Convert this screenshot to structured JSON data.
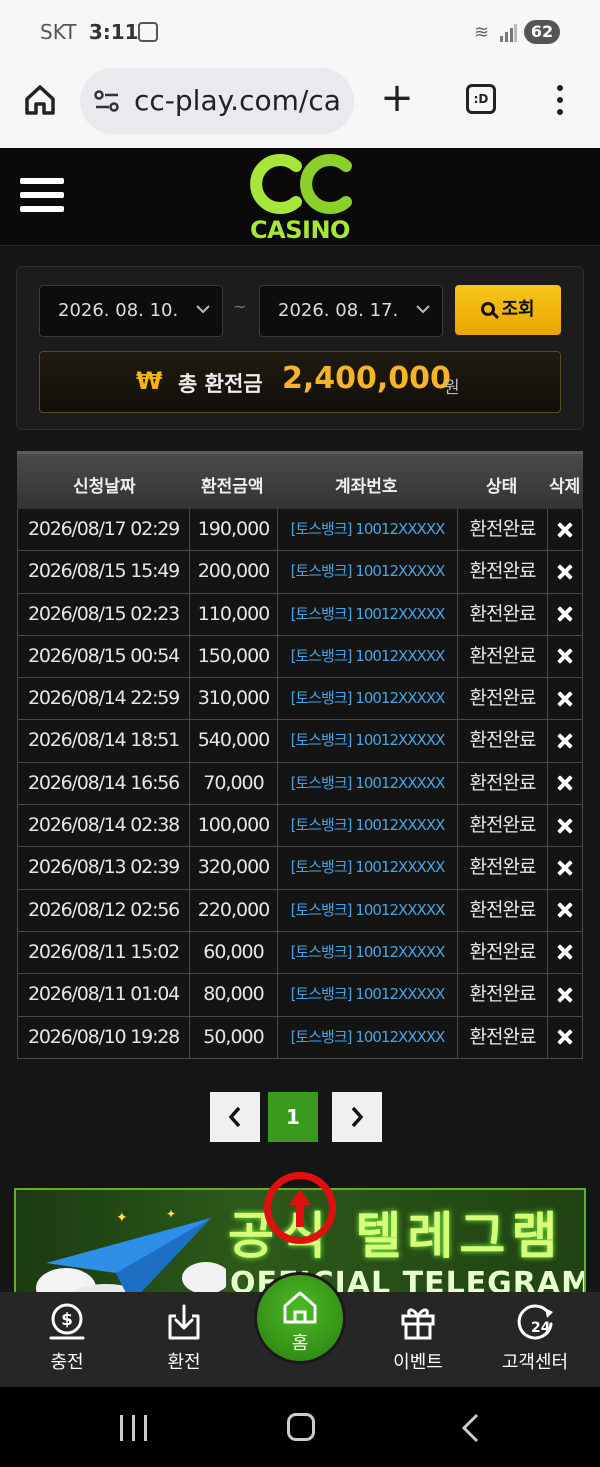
{
  "status_bar": {
    "carrier": "SKT",
    "time": "3:11",
    "battery": "62"
  },
  "browser": {
    "url": "cc-play.com/ca",
    "tabs_icon": ":D"
  },
  "site": {
    "logo_text": "CASINO"
  },
  "search": {
    "date_from": "2026. 08. 10.",
    "date_to": "2026. 08. 17.",
    "separator": "~",
    "button_label": "조회"
  },
  "summary": {
    "currency_symbol": "₩",
    "label": "총 환전금",
    "amount": "2,400,000",
    "unit": "원"
  },
  "table": {
    "headers": {
      "date": "신청날짜",
      "amount": "환전금액",
      "account": "계좌번호",
      "status": "상태",
      "delete": "삭제"
    },
    "rows": [
      {
        "date": "2026/08/17 02:29",
        "amount": "190,000",
        "account": "[토스뱅크] 10012XXXXX",
        "status": "환전완료"
      },
      {
        "date": "2026/08/15 15:49",
        "amount": "200,000",
        "account": "[토스뱅크] 10012XXXXX",
        "status": "환전완료"
      },
      {
        "date": "2026/08/15 02:23",
        "amount": "110,000",
        "account": "[토스뱅크] 10012XXXXX",
        "status": "환전완료"
      },
      {
        "date": "2026/08/15 00:54",
        "amount": "150,000",
        "account": "[토스뱅크] 10012XXXXX",
        "status": "환전완료"
      },
      {
        "date": "2026/08/14 22:59",
        "amount": "310,000",
        "account": "[토스뱅크] 10012XXXXX",
        "status": "환전완료"
      },
      {
        "date": "2026/08/14 18:51",
        "amount": "540,000",
        "account": "[토스뱅크] 10012XXXXX",
        "status": "환전완료"
      },
      {
        "date": "2026/08/14 16:56",
        "amount": "70,000",
        "account": "[토스뱅크] 10012XXXXX",
        "status": "환전완료"
      },
      {
        "date": "2026/08/14 02:38",
        "amount": "100,000",
        "account": "[토스뱅크] 10012XXXXX",
        "status": "환전완료"
      },
      {
        "date": "2026/08/13 02:39",
        "amount": "320,000",
        "account": "[토스뱅크] 10012XXXXX",
        "status": "환전완료"
      },
      {
        "date": "2026/08/12 02:56",
        "amount": "220,000",
        "account": "[토스뱅크] 10012XXXXX",
        "status": "환전완료"
      },
      {
        "date": "2026/08/11 15:02",
        "amount": "60,000",
        "account": "[토스뱅크] 10012XXXXX",
        "status": "환전완료"
      },
      {
        "date": "2026/08/11 01:04",
        "amount": "80,000",
        "account": "[토스뱅크] 10012XXXXX",
        "status": "환전완료"
      },
      {
        "date": "2026/08/10 19:28",
        "amount": "50,000",
        "account": "[토스뱅크] 10012XXXXX",
        "status": "환전완료"
      }
    ]
  },
  "pagination": {
    "current_page": "1"
  },
  "banner": {
    "title": "공식 텔레그램",
    "subtitle": "OFFICIAL TELEGRAM"
  },
  "bottom_nav": {
    "charge": "충전",
    "exchange": "환전",
    "home": "홈",
    "event": "이벤트",
    "support": "고객센터",
    "support_badge": "24"
  },
  "colors": {
    "accent_gold": "#f6b42a",
    "accent_green": "#3a9a1e",
    "link_blue": "#4aa3e0",
    "logo_green": "#a8e63a"
  }
}
